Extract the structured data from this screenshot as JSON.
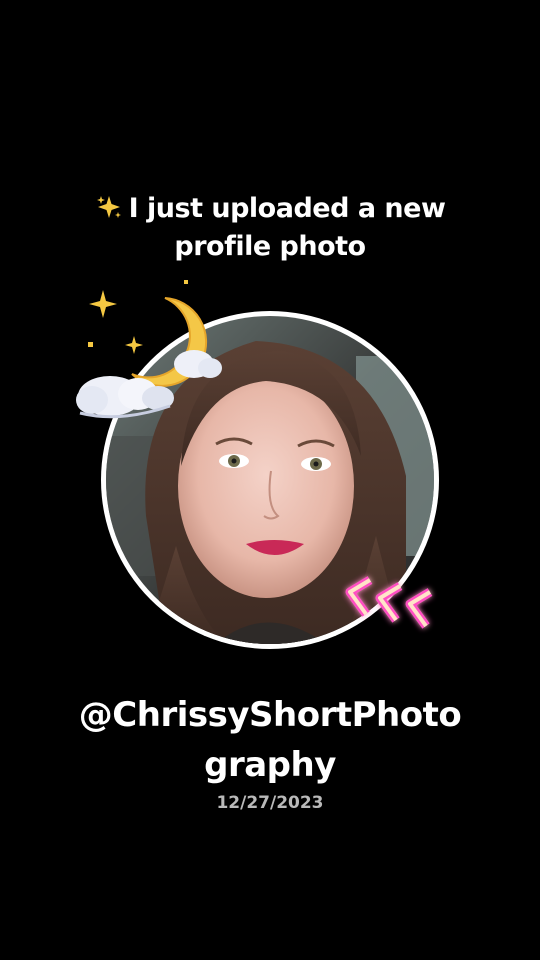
{
  "post": {
    "headline_line1": "I just uploaded a new",
    "headline_line2": "profile photo",
    "username_line1": "@ChrissyShortPhoto",
    "username_line2": "graphy",
    "date": "12/27/2023"
  },
  "icons": {
    "headline_emoji": "sparkles-icon",
    "sticker_top": "moon-clouds-icon",
    "sticker_bottom": "neon-chevrons-icon"
  },
  "colors": {
    "background": "#000000",
    "text": "#ffffff",
    "date_text": "#b9b9b9",
    "ring": "#ffffff",
    "moon": "#f7cc4a",
    "sparkle": "#f5c842",
    "chevron_neon": "#ff4fc3"
  }
}
